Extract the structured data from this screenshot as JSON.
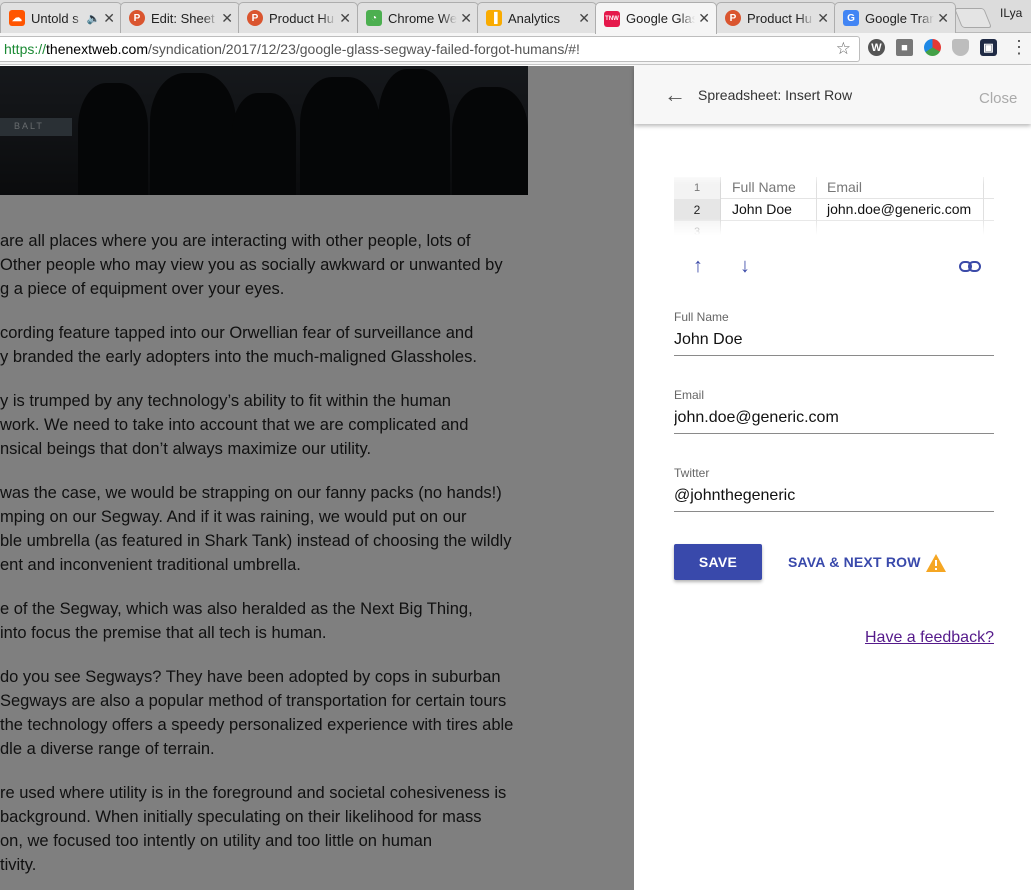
{
  "tabs": [
    {
      "title": "Untold s",
      "favicon": "soundcloud-icon",
      "color": "#ff5500",
      "glyph": "☁",
      "audio": true
    },
    {
      "title": "Edit: Sheet",
      "favicon": "producthunt-icon",
      "color": "#da552f",
      "glyph": "P"
    },
    {
      "title": "Product Hu",
      "favicon": "producthunt-icon",
      "color": "#da552f",
      "glyph": "P"
    },
    {
      "title": "Chrome We",
      "favicon": "chrome-webstore-icon",
      "color": "#4caf50",
      "glyph": "◔"
    },
    {
      "title": "Analytics",
      "favicon": "analytics-icon",
      "color": "#f9ab00",
      "glyph": "▐"
    },
    {
      "title": "Google Glas",
      "favicon": "tnw-icon",
      "color": "#e5194b",
      "glyph": "TNW",
      "active": true
    },
    {
      "title": "Product Hu",
      "favicon": "producthunt-icon",
      "color": "#da552f",
      "glyph": "P"
    },
    {
      "title": "Google Tran",
      "favicon": "google-translate-icon",
      "color": "#4285f4",
      "glyph": "G"
    }
  ],
  "profile_name": "ILya",
  "url": {
    "scheme": "https://",
    "host": "thenextweb.com",
    "path": "/syndication/2017/12/23/google-glass-segway-failed-forgot-humans/#!"
  },
  "article": {
    "hero_sign": "BALT",
    "paragraphs": [
      [
        "are all places where you are interacting with other people, lots of",
        "Other people who may view you as socially awkward or unwanted by",
        "g a piece of equipment over your eyes."
      ],
      [
        "cording feature tapped into our Orwellian fear of surveillance and",
        "y branded the early adopters into the much-maligned Glassholes."
      ],
      [
        "y is trumped by any technology’s ability to fit within the human",
        "work. We need to take into account that we are complicated and",
        "nsical beings that don’t always maximize our utility."
      ],
      [
        "was the case, we would be strapping on our fanny packs (no hands!)",
        "mping on our Segway. And if it was raining, we would put on our",
        "ble umbrella (as featured in Shark Tank) instead of choosing the wildly",
        "ent and inconvenient traditional umbrella."
      ],
      [
        "e of the Segway, which was also heralded as the Next Big Thing,",
        "into focus the premise that all tech is human."
      ],
      [
        " do you see Segways? They have been adopted by cops in suburban",
        "Segways are also a popular method of transportation for certain tours",
        "the technology offers a speedy personalized experience with tires able",
        "dle a diverse range of terrain."
      ],
      [
        "re used where utility is in the foreground and societal cohesiveness is",
        "background. When initially speculating on their likelihood for mass",
        "on, we focused too intently on utility and too little on human",
        "tivity."
      ]
    ]
  },
  "panel": {
    "title": "Spreadsheet: Insert Row",
    "close_label": "Close",
    "sheet": {
      "rows": [
        {
          "num": "1",
          "c1": "Full Name",
          "c2": "Email"
        },
        {
          "num": "2",
          "c1": "John Doe",
          "c2": "john.doe@generic.com"
        },
        {
          "num": "3",
          "c1": "",
          "c2": ""
        }
      ]
    },
    "fields": [
      {
        "label": "Full Name",
        "value": "John Doe"
      },
      {
        "label": "Email",
        "value": "john.doe@generic.com"
      },
      {
        "label": "Twitter",
        "value": "@johnthegeneric"
      }
    ],
    "save_label": "SAVE",
    "save_next_label": "SAVA & NEXT ROW",
    "warning_color": "#f5a623",
    "accent_color": "#3949ab",
    "feedback_label": "Have a feedback?"
  }
}
